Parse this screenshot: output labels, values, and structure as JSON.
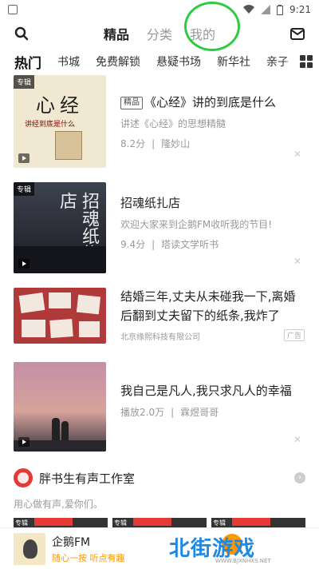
{
  "status_bar": {
    "time": "9:21"
  },
  "top_tabs": [
    {
      "label": "精品",
      "active": true
    },
    {
      "label": "分类"
    },
    {
      "label": "我的"
    }
  ],
  "categories": [
    "热门",
    "书城",
    "免费解锁",
    "悬疑书场",
    "新华社",
    "亲子"
  ],
  "feed": [
    {
      "tag": "专辑",
      "badge": "精品",
      "title": "《心经》讲的到底是什么",
      "desc": "讲述《心经》的思想精髓",
      "score": "8.2分",
      "author": "隆妙山",
      "cover_title": "心经",
      "cover_subtitle": "讲经到底是什么"
    },
    {
      "tag": "专辑",
      "title": "招魂纸扎店",
      "desc": "欢迎大家来到企鹅FM收听我的节目!",
      "score": "9.4分",
      "author": "塔读文学听书",
      "cover_title": "招魂纸扎店"
    },
    {
      "title": "结婚三年,丈夫从未碰我一下,离婚后翻到丈夫留下的纸条,我炸了",
      "company": "北京缘熙科技有限公司",
      "ad_label": "广告"
    },
    {
      "title": "我自己是凡人,我只求凡人的幸福",
      "plays": "播放2.0万",
      "author": "霖煜哥哥"
    }
  ],
  "studio": {
    "name": "胖书生有声工作室",
    "subtitle": "用心做有声,爱你们。"
  },
  "thumb_tags": [
    "专辑",
    "专辑",
    "专辑"
  ],
  "player": {
    "title": "企鹅FM",
    "subtitle": "随心一按 听点有趣"
  },
  "watermark": {
    "text": "北街游戏",
    "url": "WWW.BJXNHXS.NET"
  },
  "colors": {
    "annotation_circle": "#2ecc40",
    "accent": "#ff9800",
    "watermark_blue": "#1e88e5"
  }
}
